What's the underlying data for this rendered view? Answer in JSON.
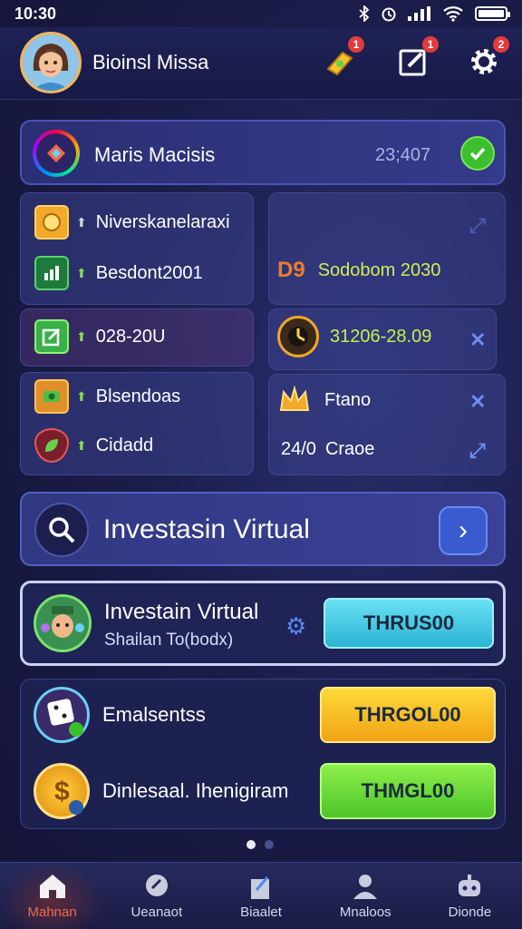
{
  "status_bar": {
    "time": "10:30"
  },
  "header": {
    "username": "Bioinsl Missa",
    "badges": [
      "1",
      "1",
      "2"
    ]
  },
  "banner": {
    "title": "Maris Macisis",
    "value": "23;407"
  },
  "stats": {
    "left": [
      {
        "label": "Niverskanelaraxi",
        "icon": "coin-icon"
      },
      {
        "label": "Besdont2001",
        "icon": "chart-icon"
      },
      {
        "label": "028-20U",
        "icon": "edit-icon"
      },
      {
        "label": "Blsendoas",
        "icon": "cash-icon"
      },
      {
        "label": "Cidadd",
        "icon": "leaf-shield-icon"
      }
    ],
    "right": [
      {
        "prefix": "D9",
        "label": "Sodobom 2030"
      },
      {
        "label": "31206-28.09",
        "icon": "timer-icon"
      },
      {
        "label": "Ftano",
        "icon": "crown-icon"
      },
      {
        "prefix": "24/0",
        "label": "Craoe"
      }
    ]
  },
  "search": {
    "label": "Investasin Virtual"
  },
  "invest": {
    "title": "Investain Virtual",
    "subtitle": "Shailan To(bodx)",
    "button": "THRUS00"
  },
  "offers": [
    {
      "label": "Emalsentss",
      "button": "THRGOL00"
    },
    {
      "label": "Dinlesaal. Ihenigiram",
      "button": "THMGL00"
    }
  ],
  "tabs": [
    {
      "label": "Mahnan",
      "icon": "home-icon",
      "active": true
    },
    {
      "label": "Ueanaot",
      "icon": "chat-icon",
      "active": false
    },
    {
      "label": "Biaalet",
      "icon": "building-icon",
      "active": false
    },
    {
      "label": "Mnaloos",
      "icon": "profile-icon",
      "active": false
    },
    {
      "label": "Dionde",
      "icon": "robot-icon",
      "active": false
    }
  ]
}
